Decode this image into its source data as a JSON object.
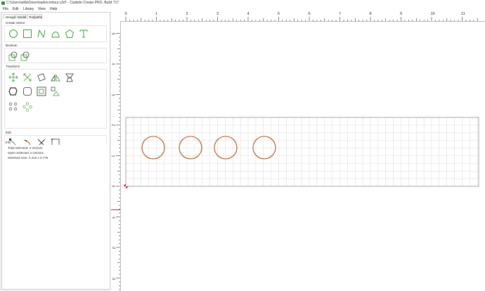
{
  "window": {
    "title": "C:\\Users\\willa\\Downloads\\contour.c2d* - Carbide Create PRO, Build 717"
  },
  "menu": [
    "File",
    "Edit",
    "Library",
    "View",
    "Help"
  ],
  "tabs": [
    "Design",
    "Model",
    "Toolpaths"
  ],
  "sections": {
    "create_vector": "Create Vector",
    "boolean": "Boolean",
    "transform": "Transform",
    "edit": "Edit",
    "info": "Info"
  },
  "info": {
    "total_selected": "Total Selected:  4 Vectors",
    "open_selected": "Open Selected:  0 Vectors",
    "selected_size": "Selected Size:  4.416 x 0.776"
  },
  "ruler": {
    "x_labels": [
      "0",
      "1",
      "2",
      "3",
      "4",
      "5",
      "6",
      "7",
      "8",
      "9",
      "10",
      "11"
    ],
    "y_labels": [
      "5",
      "4",
      "3",
      "2",
      "1",
      "0",
      "-1",
      "-2",
      "-3",
      "-4",
      "-5"
    ]
  },
  "colors": {
    "tool_green": "#3a9c3a",
    "circle_stroke": "#b5541c",
    "origin_red": "#e02020"
  },
  "icons": {
    "create_vector": [
      "circle-icon",
      "rectangle-icon",
      "polyline-icon",
      "curve-icon",
      "polygon-icon",
      "text-icon"
    ],
    "boolean": [
      "boolean-union-icon",
      "boolean-subtract-icon"
    ],
    "transform": [
      "move-icon",
      "scale-icon",
      "rotate-icon",
      "mirror-icon",
      "align-icon",
      "offset-icon",
      "round-corners-icon",
      "inset-icon",
      "tile-icon",
      "array-icon",
      "grid-array-icon"
    ],
    "edit": [
      "node-edit-icon",
      "trim-icon",
      "cut-icon",
      "join-icon"
    ]
  }
}
